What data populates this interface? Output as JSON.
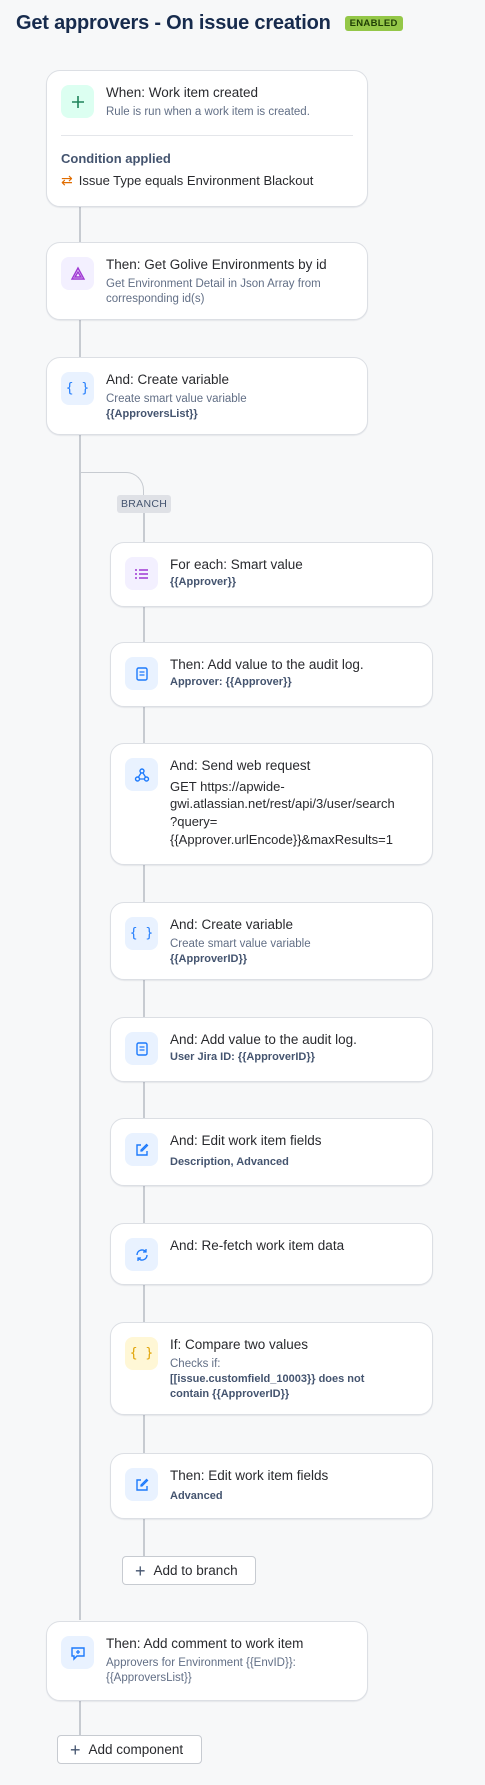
{
  "header": {
    "title": "Get approvers - On issue creation",
    "status": "ENABLED"
  },
  "trigger": {
    "icon": "plus-icon",
    "title": "When: Work item created",
    "subtitle": "Rule is run when a work item is created.",
    "condition_heading": "Condition applied",
    "condition_icon": "swap-icon",
    "condition_text": "Issue Type equals Environment Blackout"
  },
  "steps": [
    {
      "icon": "golive-logo-icon",
      "title": "Then: Get Golive Environments by id",
      "line1": "Get Environment Detail in Json Array from",
      "line2": "corresponding id(s)"
    },
    {
      "icon": "braces-icon",
      "title": "And: Create variable",
      "line1": "Create smart value variable",
      "bold": "{{ApproversList}}"
    }
  ],
  "branch": {
    "badge": "BRANCH",
    "items": [
      {
        "icon": "list-icon",
        "title": "For each: Smart value",
        "bold": "{{Approver}}"
      },
      {
        "icon": "log-icon",
        "title": "Then: Add value to the audit log.",
        "bold": "Approver: {{Approver}}"
      },
      {
        "icon": "webhook-icon",
        "title": "And: Send web request",
        "lines": [
          "GET https://apwide-",
          "gwi.atlassian.net/rest/api/3/user/search",
          "?query=",
          "{{Approver.urlEncode}}&maxResults=1"
        ]
      },
      {
        "icon": "braces-icon",
        "title": "And: Create variable",
        "line1": "Create smart value variable",
        "bold": "{{ApproverID}}"
      },
      {
        "icon": "log-icon",
        "title": "And: Add value to the audit log.",
        "bold": "User Jira ID: {{ApproverID}}"
      },
      {
        "icon": "edit-icon",
        "title": "And: Edit work item fields",
        "bold": "Description, Advanced"
      },
      {
        "icon": "refresh-icon",
        "title": "And: Re-fetch work item data"
      },
      {
        "icon": "braces-icon",
        "title": "If: Compare two values",
        "line1": "Checks if:",
        "bold1": "[[issue.customfield_10003}} does not",
        "bold2": "contain {{ApproverID}}"
      },
      {
        "icon": "edit-icon",
        "title": "Then: Edit work item fields",
        "bold": "Advanced"
      }
    ],
    "add_button": "Add to branch"
  },
  "final_step": {
    "icon": "comment-add-icon",
    "title": "Then: Add comment to work item",
    "line1": "Approvers for Environment {{EnvID}}:",
    "line2": "{{ApproversList}}"
  },
  "add_component": "Add component",
  "colors": {
    "accent_blue": "#1d7afc",
    "enabled_green": "#94c748"
  }
}
